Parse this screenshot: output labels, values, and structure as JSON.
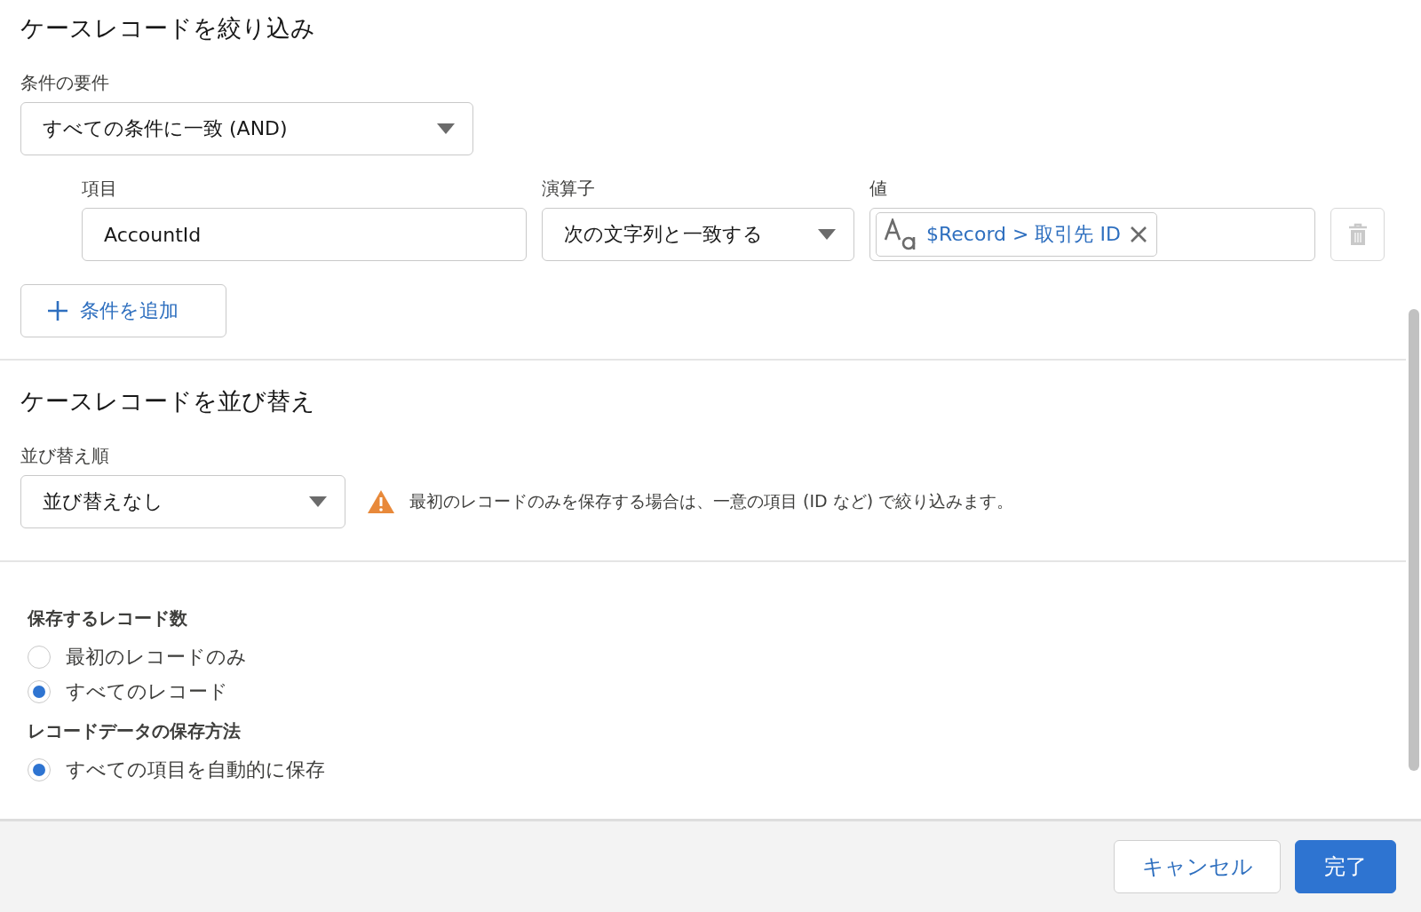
{
  "filter": {
    "title": "ケースレコードを絞り込み",
    "condition_requirement": {
      "label": "条件の要件",
      "value": "すべての条件に一致 (AND)"
    },
    "conditions": [
      {
        "field": {
          "label": "項目",
          "value": "AccountId"
        },
        "operator": {
          "label": "演算子",
          "value": "次の文字列と一致する"
        },
        "value": {
          "label": "値",
          "pill": "$Record > 取引先 ID"
        },
        "delete_disabled": true
      }
    ],
    "add_button": "条件を追加"
  },
  "sort": {
    "title": "ケースレコードを並び替え",
    "order": {
      "label": "並び替え順",
      "value": "並び替えなし"
    },
    "warning": "最初のレコードのみを保存する場合は、一意の項目 (ID など) で絞り込みます。"
  },
  "store": {
    "groups": [
      {
        "label": "保存するレコード数",
        "options": [
          {
            "label": "最初のレコードのみ",
            "selected": false
          },
          {
            "label": "すべてのレコード",
            "selected": true
          }
        ]
      },
      {
        "label": "レコードデータの保存方法",
        "options": [
          {
            "label": "すべての項目を自動的に保存",
            "selected": true
          }
        ]
      }
    ]
  },
  "footer": {
    "buttons": [
      {
        "label": "キャンセル",
        "kind": "neutral"
      },
      {
        "label": "完了",
        "kind": "brand"
      }
    ]
  }
}
